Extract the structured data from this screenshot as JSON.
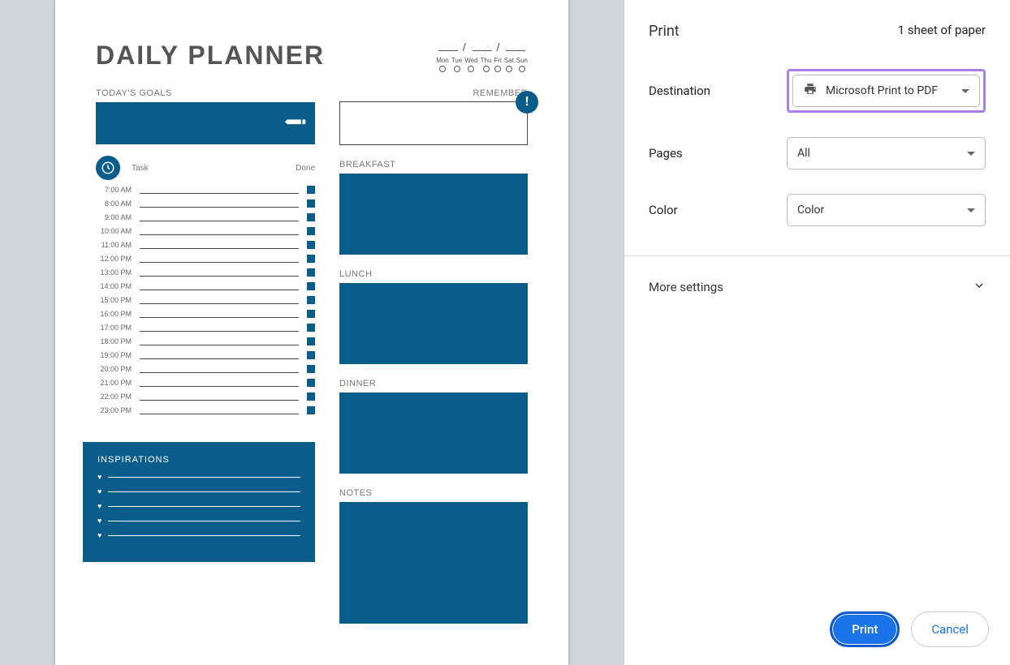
{
  "preview": {
    "title": "DAILY PLANNER",
    "days": [
      "Mon",
      "Tue",
      "Wed",
      "Thu",
      "Fri",
      "Sat",
      "Sun"
    ],
    "goals_label": "TODAY'S GOALS",
    "task_header": "Task",
    "done_header": "Done",
    "times": [
      "7:00 AM",
      "8:00 AM",
      "9:00 AM",
      "10:00 AM",
      "11:00 AM",
      "12:00 PM",
      "13:00 PM",
      "14:00 PM",
      "15:00 PM",
      "16:00 PM",
      "17:00 PM",
      "18:00 PM",
      "19:00 PM",
      "20:00 PM",
      "21:00 PM",
      "22:00 PM",
      "23:00 PM"
    ],
    "inspirations_label": "INSPIRATIONS",
    "remember_label": "REMEMBER",
    "breakfast_label": "BREAKFAST",
    "lunch_label": "LUNCH",
    "dinner_label": "DINNER",
    "notes_label": "NOTES"
  },
  "panel": {
    "title": "Print",
    "sheet_info": "1 sheet of paper",
    "destination_label": "Destination",
    "destination_value": "Microsoft Print to PDF",
    "pages_label": "Pages",
    "pages_value": "All",
    "color_label": "Color",
    "color_value": "Color",
    "more_label": "More settings",
    "print_btn": "Print",
    "cancel_btn": "Cancel"
  }
}
